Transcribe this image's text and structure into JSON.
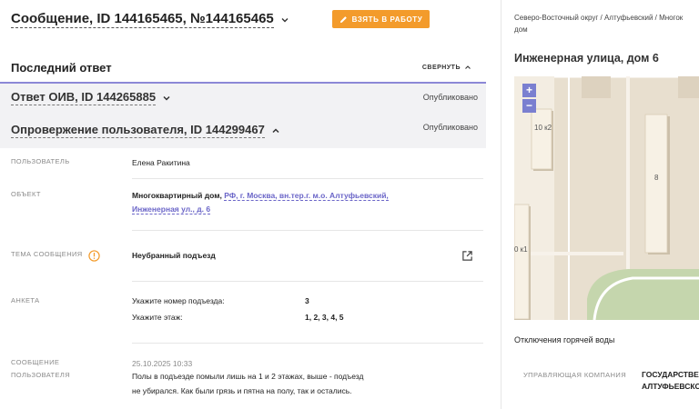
{
  "header": {
    "title": "Сообщение, ID 144165465, №144165465",
    "take_button": "ВЗЯТЬ В РАБОТУ"
  },
  "last_answer": {
    "title": "Последний ответ",
    "collapse_label": "СВЕРНУТЬ"
  },
  "answers": [
    {
      "title": "Ответ ОИВ, ID 144265885",
      "status": "Опубликовано"
    },
    {
      "title": "Опровержение пользователя, ID 144299467",
      "status": "Опубликовано"
    }
  ],
  "fields": {
    "user": {
      "label": "ПОЛЬЗОВАТЕЛЬ",
      "value": "Елена Ракитина"
    },
    "object": {
      "label": "ОБЪЕКТ",
      "type": "Многоквартирный дом,",
      "address_line1": "РФ, г. Москва, вн.тер.г. м.о. Алтуфьевский,",
      "address_line2": "Инженерная ул., д. 6"
    },
    "topic": {
      "label": "ТЕМА СООБЩЕНИЯ",
      "value": "Неубранный подъезд"
    },
    "survey": {
      "label": "АНКЕТА",
      "rows": [
        {
          "question": "Укажите номер подъезда:",
          "answer": "3"
        },
        {
          "question": "Укажите этаж:",
          "answer": "1, 2, 3, 4, 5"
        }
      ]
    },
    "message": {
      "label_line1": "СООБЩЕНИЕ",
      "label_line2": "ПОЛЬЗОВАТЕЛЯ",
      "date": "25.10.2025 10:33",
      "text_line1": "Полы в подъезде помыли лишь на 1 и 2 этажах, выше - подъезд",
      "text_line2": "не убирался. Как были грязь и пятна на полу, так и остались."
    }
  },
  "right_panel": {
    "breadcrumb_line1": "Северо-Восточный округ / Алтуфьевский / Многок",
    "breadcrumb_line2": "дом",
    "address_title": "Инженерная улица, дом 6",
    "map": {
      "zoom_in": "+",
      "zoom_out": "−",
      "buildings": [
        "10 к2",
        "8",
        "0 к1"
      ]
    },
    "outage_title": "Отключения горячей воды",
    "company_label": "УПРАВЛЯЮЩАЯ КОМПАНИЯ",
    "company_value_line1": "ГОСУДАРСТВЕН",
    "company_value_line2": "АЛТУФЬЕВСКО"
  },
  "colors": {
    "accent_orange": "#f39b2b",
    "link_purple": "#6b66c8",
    "zoom_purple": "#7a7fd0",
    "warning_orange": "#f39b2b"
  },
  "icons": [
    "chevron-down-icon",
    "pencil-icon",
    "chevron-up-icon",
    "warning-icon",
    "external-link-icon",
    "plus-icon",
    "minus-icon"
  ]
}
